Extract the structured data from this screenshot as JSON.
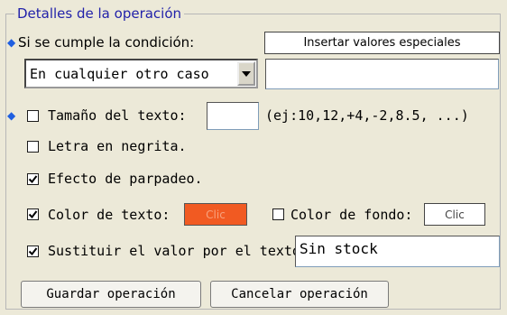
{
  "operation": {
    "legend": "Detalles de la operación",
    "condition_label": "Si se cumple la condición:",
    "insert_special_label": "Insertar valores especiales",
    "condition_select_value": "En cualquier otro caso",
    "condition_value": "",
    "text_size": {
      "label": "Tamaño del texto:",
      "value": "",
      "hint": "(ej:10,12,+4,-2,8.5, ...)",
      "checked": false
    },
    "bold": {
      "label": "Letra en negrita.",
      "checked": false
    },
    "blink": {
      "label": "Efecto de parpadeo.",
      "checked": true
    },
    "text_color": {
      "label": "Color de texto:",
      "button": "Clic",
      "checked": true,
      "swatch": "#f15a22"
    },
    "bg_color": {
      "label": "Color de fondo:",
      "button": "Clic",
      "checked": false
    },
    "replace": {
      "label": "Sustituir el valor por el texto:",
      "value": "Sin stock",
      "checked": true
    },
    "save_label": "Guardar operación",
    "cancel_label": "Cancelar operación"
  },
  "icons": {
    "required_marker": "diamond-icon",
    "dropdown": "chevron-down-icon",
    "check": "checkmark-icon"
  },
  "colors": {
    "accent": "#1f5fe0",
    "legend_text": "#2222aa",
    "background": "#ece9d8",
    "swatch_orange": "#f15a22"
  }
}
